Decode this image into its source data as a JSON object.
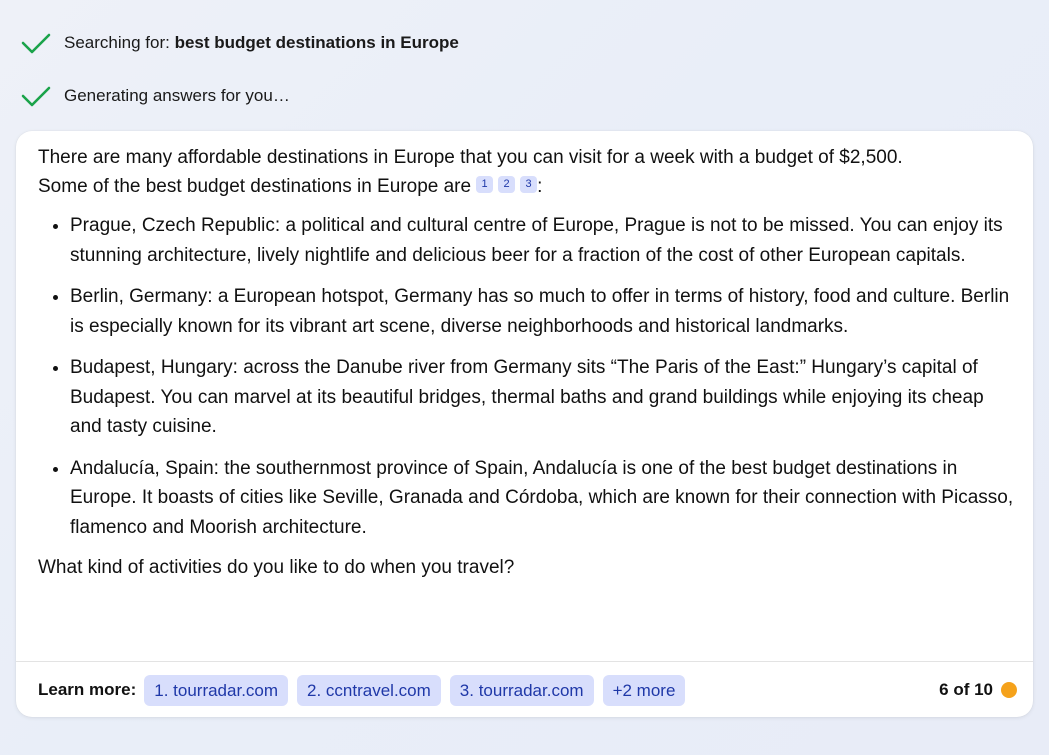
{
  "status": {
    "searching_prefix": "Searching for: ",
    "search_query": "best budget destinations in Europe",
    "generating": "Generating answers for you…",
    "check_color": "#1aa34a",
    "check_icon": "checkmark-icon"
  },
  "answer": {
    "intro_line1": "There are many affordable destinations in Europe that you can visit for a week with a budget of $2,500.",
    "intro_line2": "Some of the best budget destinations in Europe are",
    "intro_colon": ":",
    "citations": [
      "1",
      "2",
      "3"
    ],
    "bullets": [
      "Prague, Czech Republic: a political and cultural centre of Europe, Prague is not to be missed. You can enjoy its stunning architecture, lively nightlife and delicious beer for a fraction of the cost of other European capitals.",
      "Berlin, Germany: a European hotspot, Germany has so much to offer in terms of history, food and culture. Berlin is especially known for its vibrant art scene, diverse neighborhoods and historical landmarks.",
      "Budapest, Hungary: across the Danube river from Germany sits “The Paris of the East:” Hungary’s capital of Budapest. You can marvel at its beautiful bridges, thermal baths and grand buildings while enjoying its cheap and tasty cuisine.",
      "Andalucía, Spain: the southernmost province of Spain, Andalucía is one of the best budget destinations in Europe. It boasts of cities like Seville, Granada and Córdoba, which are known for their connection with Picasso, flamenco and Moorish architecture."
    ],
    "question": "What kind of activities do you like to do when you travel?"
  },
  "footer": {
    "learn_more_label": "Learn more:",
    "links": [
      "1. tourradar.com",
      "2. ccntravel.com",
      "3. tourradar.com",
      "+2 more"
    ],
    "turn_count": "6 of 10",
    "indicator_color": "#f5a21b"
  },
  "colors": {
    "chip_bg": "#d8defc",
    "chip_text": "#1f38a8"
  }
}
